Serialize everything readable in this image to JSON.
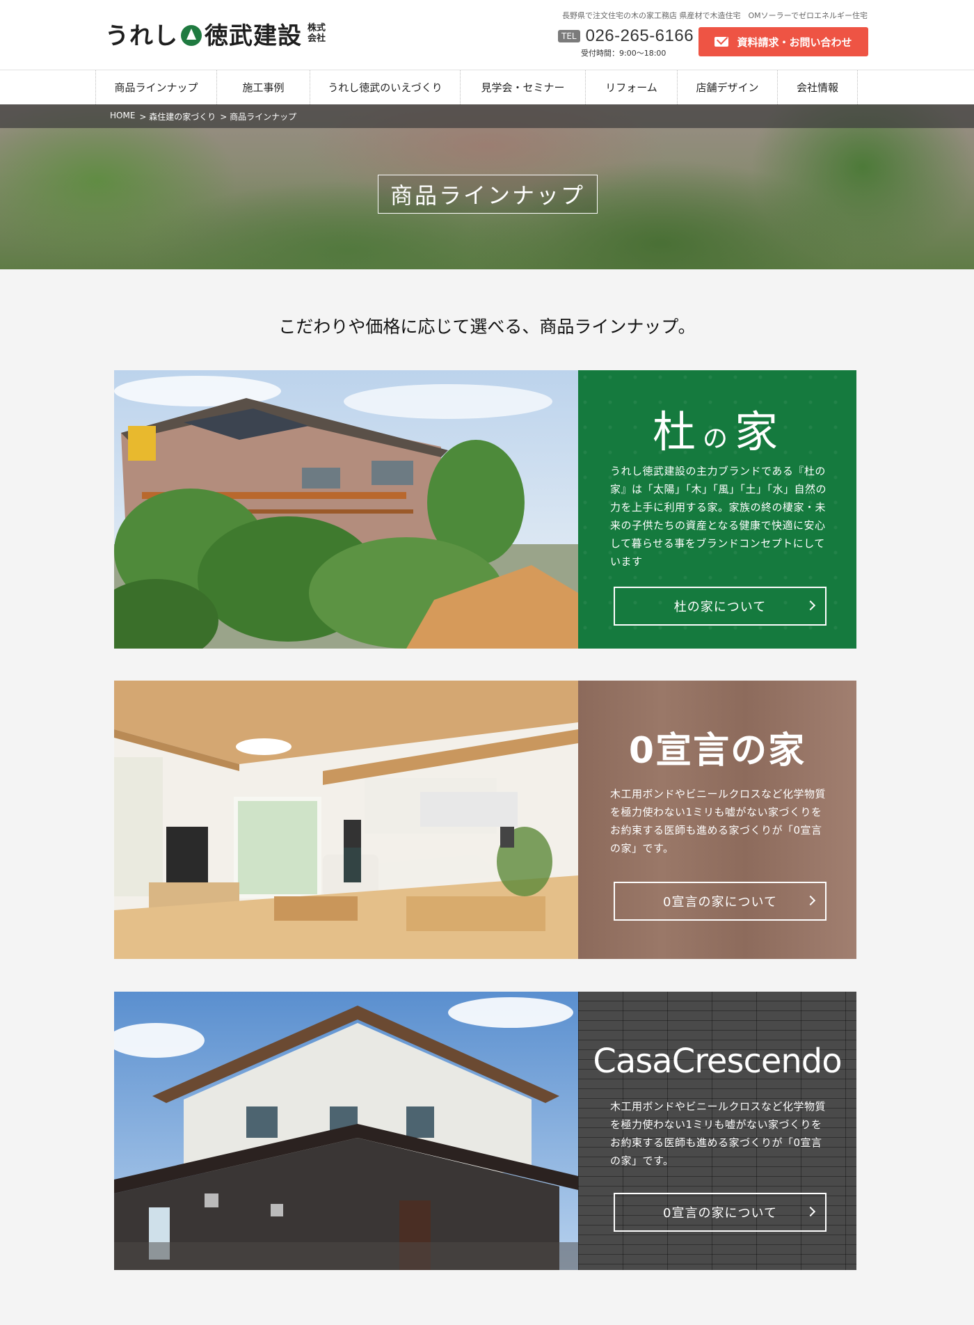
{
  "header": {
    "logo_text_1": "うれし",
    "logo_text_2": "徳武建設",
    "logo_kabu": "株式会社",
    "tagline": "長野県で注文住宅の木の家工務店 県産材で木造住宅　OMソーラーでゼロエネルギー住宅",
    "tel_badge": "TEL",
    "tel": "026-265-6166",
    "hours": "受付時間：9:00〜18:00",
    "contact_label": "資料請求・お問い合わせ"
  },
  "nav": [
    {
      "label": "商品ラインナップ"
    },
    {
      "label": "施工事例"
    },
    {
      "label": "うれし徳武のいえづくり"
    },
    {
      "label": "見学会・セミナー"
    },
    {
      "label": "リフォーム"
    },
    {
      "label": "店舗デザイン"
    },
    {
      "label": "会社情報"
    }
  ],
  "breadcrumb": [
    "HOME",
    "> 森住建の家づくり",
    "> 商品ラインナップ"
  ],
  "hero_title": "商品ラインナップ",
  "intro": "こだわりや価格に応じて選べる、商品ラインナップ。",
  "products": [
    {
      "brand_a": "杜",
      "brand_b": "の",
      "brand_c": "家",
      "desc": "うれし徳武建設の主力ブランドである『杜の家』は「太陽」「木」「風」「土」「水」自然の力を上手に利用する家。家族の終の棲家・未来の子供たちの資産となる健康で快適に安心して暮らせる事をブランドコンセプトにしています",
      "button": "杜の家について"
    },
    {
      "brand": "0宣言の家",
      "desc": "木工用ボンドやビニールクロスなど化学物質を極力使わない1ミリも嘘がない家づくりをお約束する医師も進める家づくりが「0宣言の家」です。",
      "button": "0宣言の家について"
    },
    {
      "brand": "CasaCrescendo",
      "desc": "木工用ボンドやビニールクロスなど化学物質を極力使わない1ミリも嘘がない家づくりをお約束する医師も進める家づくりが「0宣言の家」です。",
      "button": "0宣言の家について"
    }
  ],
  "colors": {
    "accent_red": "#ee5444",
    "mori_green": "#157a3e",
    "wood_brown": "#9a7868",
    "casa_gray": "#4a4a4a"
  }
}
